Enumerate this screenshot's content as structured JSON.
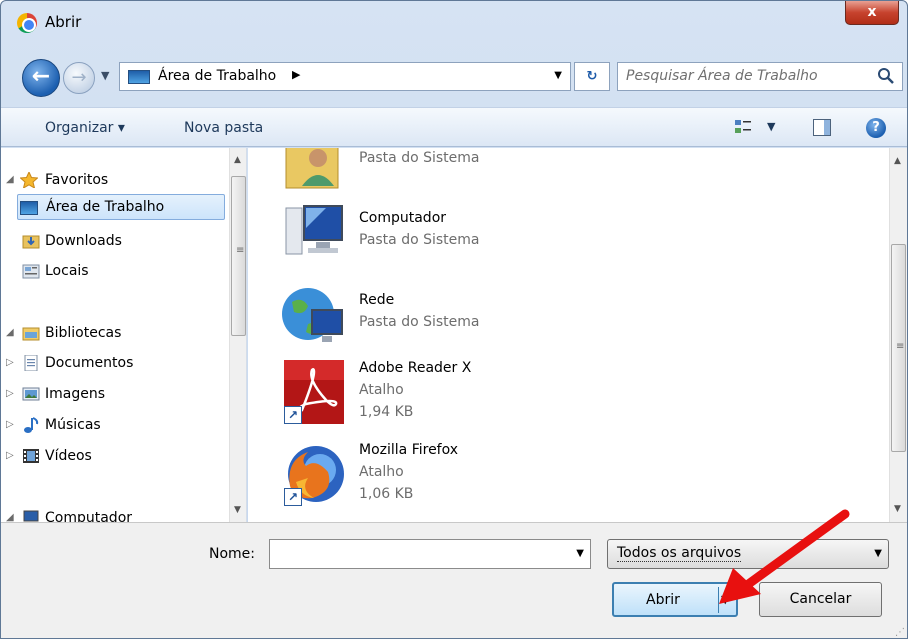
{
  "window": {
    "title": "Abrir",
    "close_glyph": "x"
  },
  "address": {
    "back_glyph": "←",
    "forward_glyph": "→",
    "recent_glyph": "▼",
    "location": "Área de Trabalho",
    "separator_glyph": "▶",
    "drop_glyph": "▼",
    "refresh_glyph": "↻"
  },
  "search": {
    "placeholder": "Pesquisar Área de Trabalho"
  },
  "toolbar": {
    "organize_label": "Organizar ▾",
    "new_folder_label": "Nova pasta",
    "views_drop_glyph": "▼",
    "help_glyph": "?"
  },
  "nav": {
    "favorites_label": "Favoritos",
    "desktop_label": "Área de Trabalho",
    "downloads_label": "Downloads",
    "places_label": "Locais",
    "libraries_label": "Bibliotecas",
    "documents_label": "Documentos",
    "images_label": "Imagens",
    "music_label": "Músicas",
    "videos_label": "Vídeos",
    "computer_label": "Computador",
    "expanded_glyph": "◢",
    "collapsed_glyph": "▷",
    "scroll_up_glyph": "▲",
    "scroll_down_glyph": "▼",
    "grip_glyph": "≡"
  },
  "files": [
    {
      "name": "",
      "sub": "Pasta do Sistema",
      "icon": "user-folder-icon"
    },
    {
      "name": "Computador",
      "sub": "Pasta do Sistema",
      "icon": "computer-icon"
    },
    {
      "name": "Rede",
      "sub": "Pasta do Sistema",
      "icon": "network-icon"
    },
    {
      "name": "Adobe Reader X",
      "sub": "Atalho",
      "size": "1,94 KB",
      "icon": "adobe-reader-icon"
    },
    {
      "name": "Mozilla Firefox",
      "sub": "Atalho",
      "size": "1,06 KB",
      "icon": "firefox-icon"
    }
  ],
  "shortcut_glyph": "↗",
  "bottom": {
    "name_label": "Nome:",
    "name_value": "",
    "name_drop_glyph": "▼",
    "file_type": "Todos os arquivos",
    "type_drop_glyph": "▼",
    "open_label": "Abrir",
    "open_arrow_glyph": "▼",
    "cancel_label": "Cancelar",
    "grip_glyph": "⋰"
  },
  "colors": {
    "annotation_arrow": "#e8100f",
    "accent": "#3c7fb1"
  }
}
